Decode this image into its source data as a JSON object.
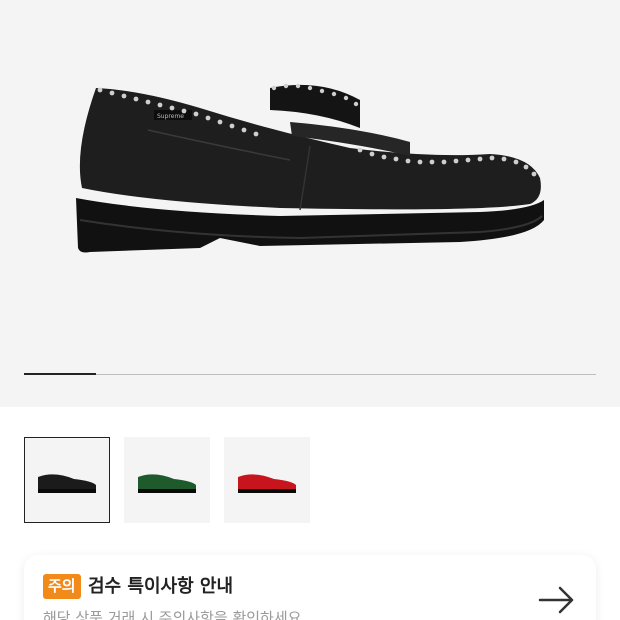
{
  "hero": {
    "image": "black-studded-loafer-product-image",
    "brand_tag": "Supreme",
    "carousel_progress": 0.125
  },
  "thumbnails": [
    {
      "name": "black",
      "color": "#1b1b1b",
      "selected": true
    },
    {
      "name": "green",
      "color": "#1f5a2c",
      "selected": false
    },
    {
      "name": "red",
      "color": "#c8141c",
      "selected": false
    }
  ],
  "notice": {
    "badge": "주의",
    "title": "검수 특이사항 안내",
    "description": "해당 상품 거래 시 주의사항을 확인하세요",
    "arrow_icon": "arrow-right-icon",
    "accent_color": "#f28a1a"
  }
}
